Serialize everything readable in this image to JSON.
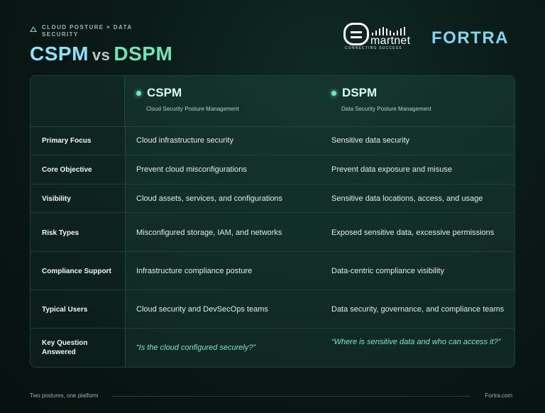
{
  "header": {
    "eyebrow": "Cloud Posture × Data Security",
    "title_a": "CSPM",
    "title_vs": "vs",
    "title_b": "DSPM"
  },
  "logos": {
    "smartnet_word": "martnet",
    "smartnet_tagline": "CONNECTING SUCCESS",
    "fortra": "FORTRA"
  },
  "table": {
    "columns": [
      {
        "name": "CSPM",
        "subtitle": "Cloud Security Posture Management"
      },
      {
        "name": "DSPM",
        "subtitle": "Data Security Posture Management"
      }
    ],
    "rows": [
      {
        "label": "Primary Focus",
        "cspm": "Cloud infrastructure security",
        "dspm": "Sensitive data security"
      },
      {
        "label": "Core Objective",
        "cspm": "Prevent cloud misconfigurations",
        "dspm": "Prevent data exposure and misuse"
      },
      {
        "label": "Visibility",
        "cspm": "Cloud assets, services, and configurations",
        "dspm": "Sensitive data locations, access, and usage"
      },
      {
        "label": "Risk Types",
        "cspm": "Misconfigured storage, IAM, and networks",
        "dspm": "Exposed sensitive data, excessive permissions"
      },
      {
        "label": "Compliance Support",
        "cspm": "Infrastructure compliance posture",
        "dspm": "Data-centric compliance visibility"
      },
      {
        "label": "Typical Users",
        "cspm": "Cloud security and DevSecOps teams",
        "dspm": "Data security, governance, and compliance teams"
      },
      {
        "label": "Key Question Answered",
        "cspm": "“Is the cloud configured securely?”",
        "dspm": "“Where is sensitive data and who can access it?”"
      }
    ]
  },
  "footer": {
    "left": "Two postures, one platform",
    "right": "Fortra.com"
  },
  "colors": {
    "accent_green": "#6ee7b7",
    "accent_blue": "#8be3ff",
    "background": "#0a1a17"
  }
}
